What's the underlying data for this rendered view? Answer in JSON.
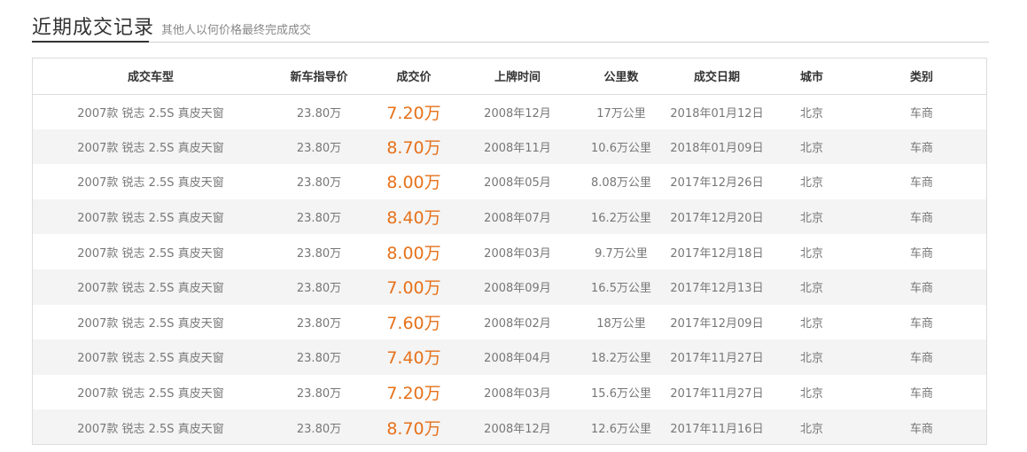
{
  "header": {
    "title": "近期成交记录",
    "subtitle": "其他人以何价格最终完成成交"
  },
  "table": {
    "columns": [
      "成交车型",
      "新车指导价",
      "成交价",
      "上牌时间",
      "公里数",
      "成交日期",
      "城市",
      "类别"
    ],
    "rows": [
      {
        "model": "2007款 锐志 2.5S 真皮天窗",
        "guide_price": "23.80万",
        "deal_price": "7.20万",
        "reg_date": "2008年12月",
        "mileage": "17万公里",
        "deal_date": "2018年01月12日",
        "city": "北京",
        "type": "车商"
      },
      {
        "model": "2007款 锐志 2.5S 真皮天窗",
        "guide_price": "23.80万",
        "deal_price": "8.70万",
        "reg_date": "2008年11月",
        "mileage": "10.6万公里",
        "deal_date": "2018年01月09日",
        "city": "北京",
        "type": "车商"
      },
      {
        "model": "2007款 锐志 2.5S 真皮天窗",
        "guide_price": "23.80万",
        "deal_price": "8.00万",
        "reg_date": "2008年05月",
        "mileage": "8.08万公里",
        "deal_date": "2017年12月26日",
        "city": "北京",
        "type": "车商"
      },
      {
        "model": "2007款 锐志 2.5S 真皮天窗",
        "guide_price": "23.80万",
        "deal_price": "8.40万",
        "reg_date": "2008年07月",
        "mileage": "16.2万公里",
        "deal_date": "2017年12月20日",
        "city": "北京",
        "type": "车商"
      },
      {
        "model": "2007款 锐志 2.5S 真皮天窗",
        "guide_price": "23.80万",
        "deal_price": "8.00万",
        "reg_date": "2008年03月",
        "mileage": "9.7万公里",
        "deal_date": "2017年12月18日",
        "city": "北京",
        "type": "车商"
      },
      {
        "model": "2007款 锐志 2.5S 真皮天窗",
        "guide_price": "23.80万",
        "deal_price": "7.00万",
        "reg_date": "2008年09月",
        "mileage": "16.5万公里",
        "deal_date": "2017年12月13日",
        "city": "北京",
        "type": "车商"
      },
      {
        "model": "2007款 锐志 2.5S 真皮天窗",
        "guide_price": "23.80万",
        "deal_price": "7.60万",
        "reg_date": "2008年02月",
        "mileage": "18万公里",
        "deal_date": "2017年12月09日",
        "city": "北京",
        "type": "车商"
      },
      {
        "model": "2007款 锐志 2.5S 真皮天窗",
        "guide_price": "23.80万",
        "deal_price": "7.40万",
        "reg_date": "2008年04月",
        "mileage": "18.2万公里",
        "deal_date": "2017年11月27日",
        "city": "北京",
        "type": "车商"
      },
      {
        "model": "2007款 锐志 2.5S 真皮天窗",
        "guide_price": "23.80万",
        "deal_price": "7.20万",
        "reg_date": "2008年03月",
        "mileage": "15.6万公里",
        "deal_date": "2017年11月27日",
        "city": "北京",
        "type": "车商"
      },
      {
        "model": "2007款 锐志 2.5S 真皮天窗",
        "guide_price": "23.80万",
        "deal_price": "8.70万",
        "reg_date": "2008年12月",
        "mileage": "12.6万公里",
        "deal_date": "2017年11月16日",
        "city": "北京",
        "type": "车商"
      }
    ]
  },
  "colors": {
    "price_accent": "#e6711a",
    "stripe": "#f4f4f4",
    "border": "#dcdcdc"
  }
}
